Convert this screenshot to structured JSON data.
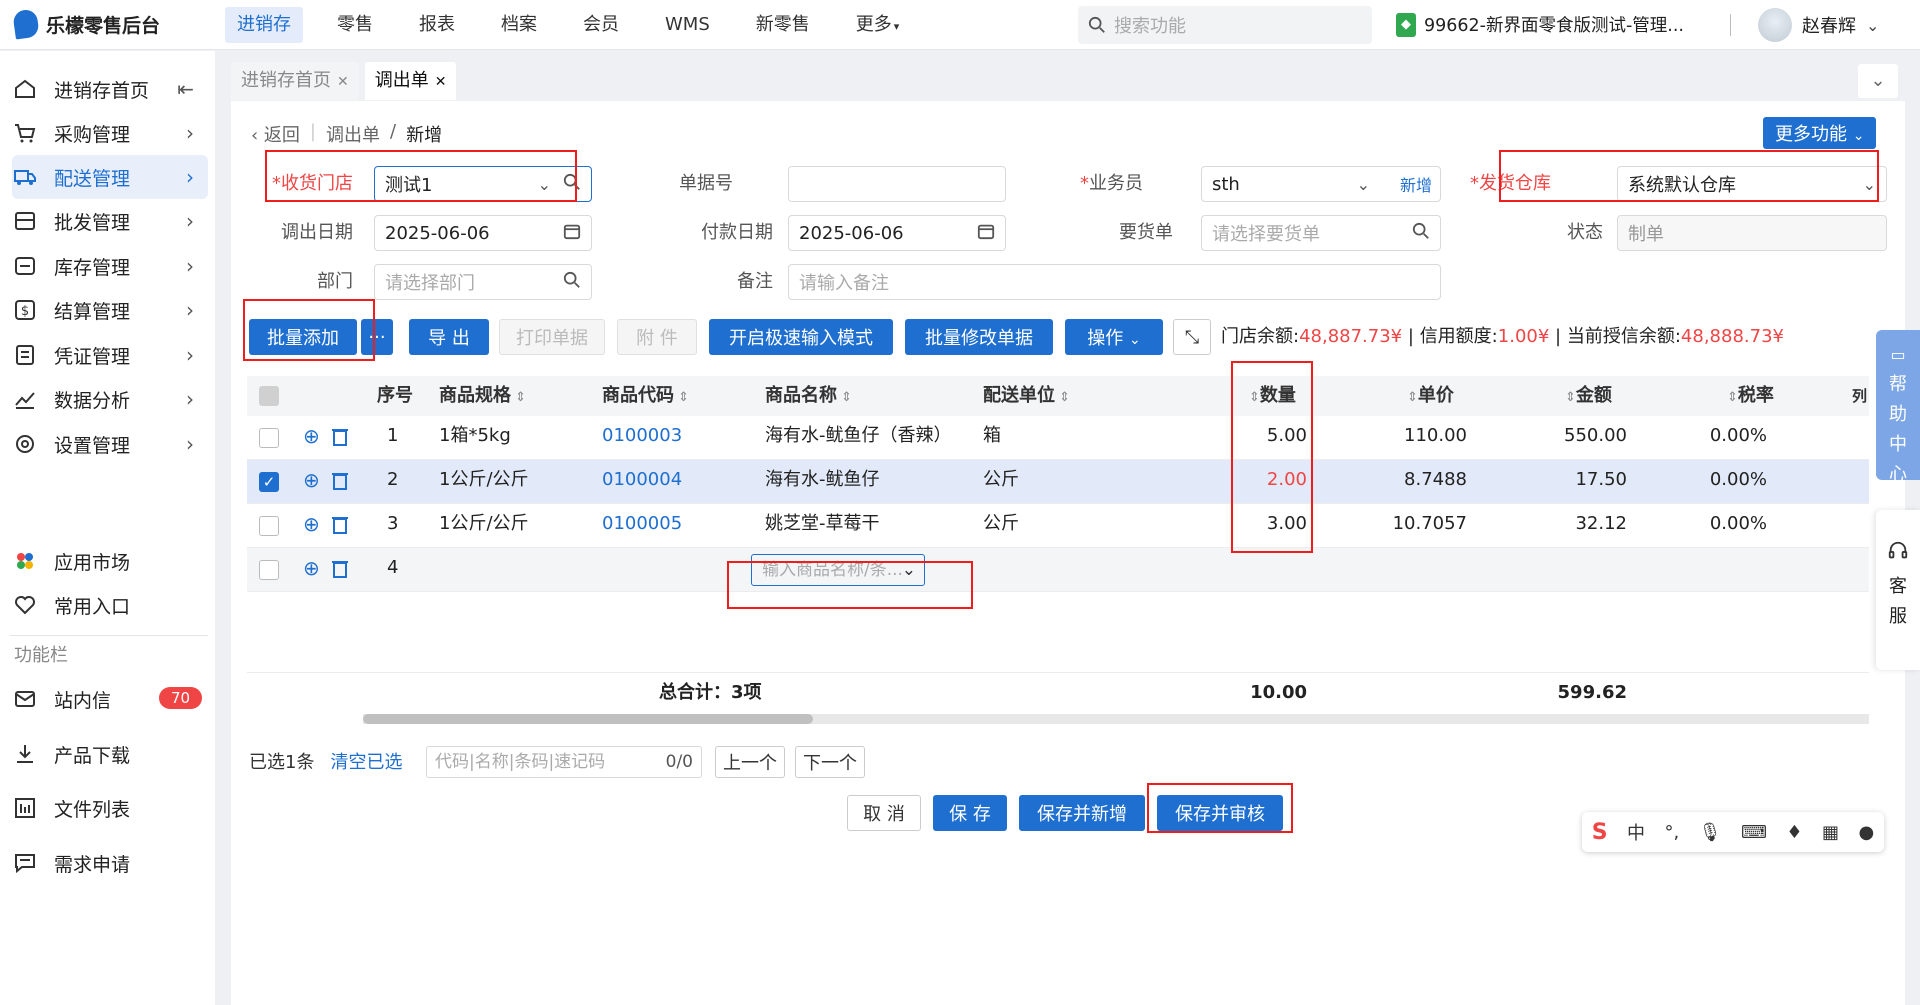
{
  "app": {
    "logo_text": "乐檬零售后台"
  },
  "nav": [
    "进销存",
    "零售",
    "报表",
    "档案",
    "会员",
    "WMS",
    "新零售",
    "更多"
  ],
  "top_search_placeholder": "搜索功能",
  "store_name": "99662-新界面零食版测试-管理...",
  "user_name": "赵春辉",
  "sidebar": {
    "items": [
      "进销存首页",
      "采购管理",
      "配送管理",
      "批发管理",
      "库存管理",
      "结算管理",
      "凭证管理",
      "数据分析",
      "设置管理"
    ],
    "extra": [
      "应用市场",
      "常用入口"
    ],
    "section_label": "功能栏",
    "tools": [
      "站内信",
      "产品下载",
      "文件列表",
      "需求申请"
    ],
    "badge": "70"
  },
  "tabs": [
    {
      "label": "进销存首页"
    },
    {
      "label": "调出单"
    }
  ],
  "breadcrumb": {
    "back": "返回",
    "path": "调出单",
    "sep": "/",
    "current": "新增"
  },
  "more_functions": "更多功能",
  "form": {
    "receive_store_label": "收货门店",
    "receive_store_value": "测试1",
    "doc_no_label": "单据号",
    "doc_no_value": "",
    "salesman_label": "业务员",
    "salesman_value": "sth",
    "salesman_add": "新增",
    "ship_wh_label": "发货仓库",
    "ship_wh_value": "系统默认仓库",
    "out_date_label": "调出日期",
    "out_date_value": "2025-06-06",
    "pay_date_label": "付款日期",
    "pay_date_value": "2025-06-06",
    "req_order_label": "要货单",
    "req_order_placeholder": "请选择要货单",
    "status_label": "状态",
    "status_value": "制单",
    "dept_label": "部门",
    "dept_placeholder": "请选择部门",
    "remark_label": "备注",
    "remark_placeholder": "请输入备注"
  },
  "toolbar": {
    "batch_add": "批量添加",
    "more_dots": "···",
    "export": "导 出",
    "print": "打印单据",
    "attach": "附 件",
    "fast_input": "开启极速输入模式",
    "batch_edit": "批量修改单据",
    "ops": "操作"
  },
  "balance": {
    "store_balance_label": "门店余额:",
    "store_balance": "48,887.73¥",
    "credit_label": "信用额度:",
    "credit": "1.00¥",
    "sep": "|",
    "avail_label": "当前授信余额:",
    "avail": "48,888.73¥"
  },
  "grid": {
    "headers": {
      "seq": "序号",
      "spec": "商品规格",
      "code": "商品代码",
      "name": "商品名称",
      "unit": "配送单位",
      "qty": "数量",
      "price": "单价",
      "amount": "金额",
      "tax": "税率",
      "col": "列"
    },
    "rows": [
      {
        "seq": "1",
        "spec": "1箱*5kg",
        "code": "0100003",
        "name": "海有水-鱿鱼仔（香辣）",
        "unit": "箱",
        "qty": "5.00",
        "price": "110.00",
        "amount": "550.00",
        "tax": "0.00%"
      },
      {
        "seq": "2",
        "spec": "1公斤/公斤",
        "code": "0100004",
        "name": "海有水-鱿鱼仔",
        "unit": "公斤",
        "qty": "2.00",
        "price": "8.7488",
        "amount": "17.50",
        "tax": "0.00%"
      },
      {
        "seq": "3",
        "spec": "1公斤/公斤",
        "code": "0100005",
        "name": "姚芝堂-草莓干",
        "unit": "公斤",
        "qty": "3.00",
        "price": "10.7057",
        "amount": "32.12",
        "tax": "0.00%"
      }
    ],
    "new_row_seq": "4",
    "new_row_placeholder": "输入商品名称/条...",
    "total_label": "总合计：3项",
    "total_qty": "10.00",
    "total_amount": "599.62"
  },
  "footer": {
    "selected": "已选1条",
    "clear": "清空已选",
    "quick_placeholder": "代码|名称|条码|速记码",
    "quick_count": "0/0",
    "prev": "上一个",
    "next": "下一个",
    "cancel": "取 消",
    "save": "保 存",
    "save_new": "保存并新增",
    "save_audit": "保存并审核"
  },
  "dock": {
    "help": [
      "帮",
      "助",
      "中",
      "心"
    ],
    "service": [
      "客",
      "服"
    ]
  },
  "ime": {
    "logo": "S",
    "lang": "中",
    "punct": "°,"
  },
  "colors": {
    "primary": "#1f6fd0",
    "danger": "#f04545",
    "highlight": "#f01d1d"
  }
}
